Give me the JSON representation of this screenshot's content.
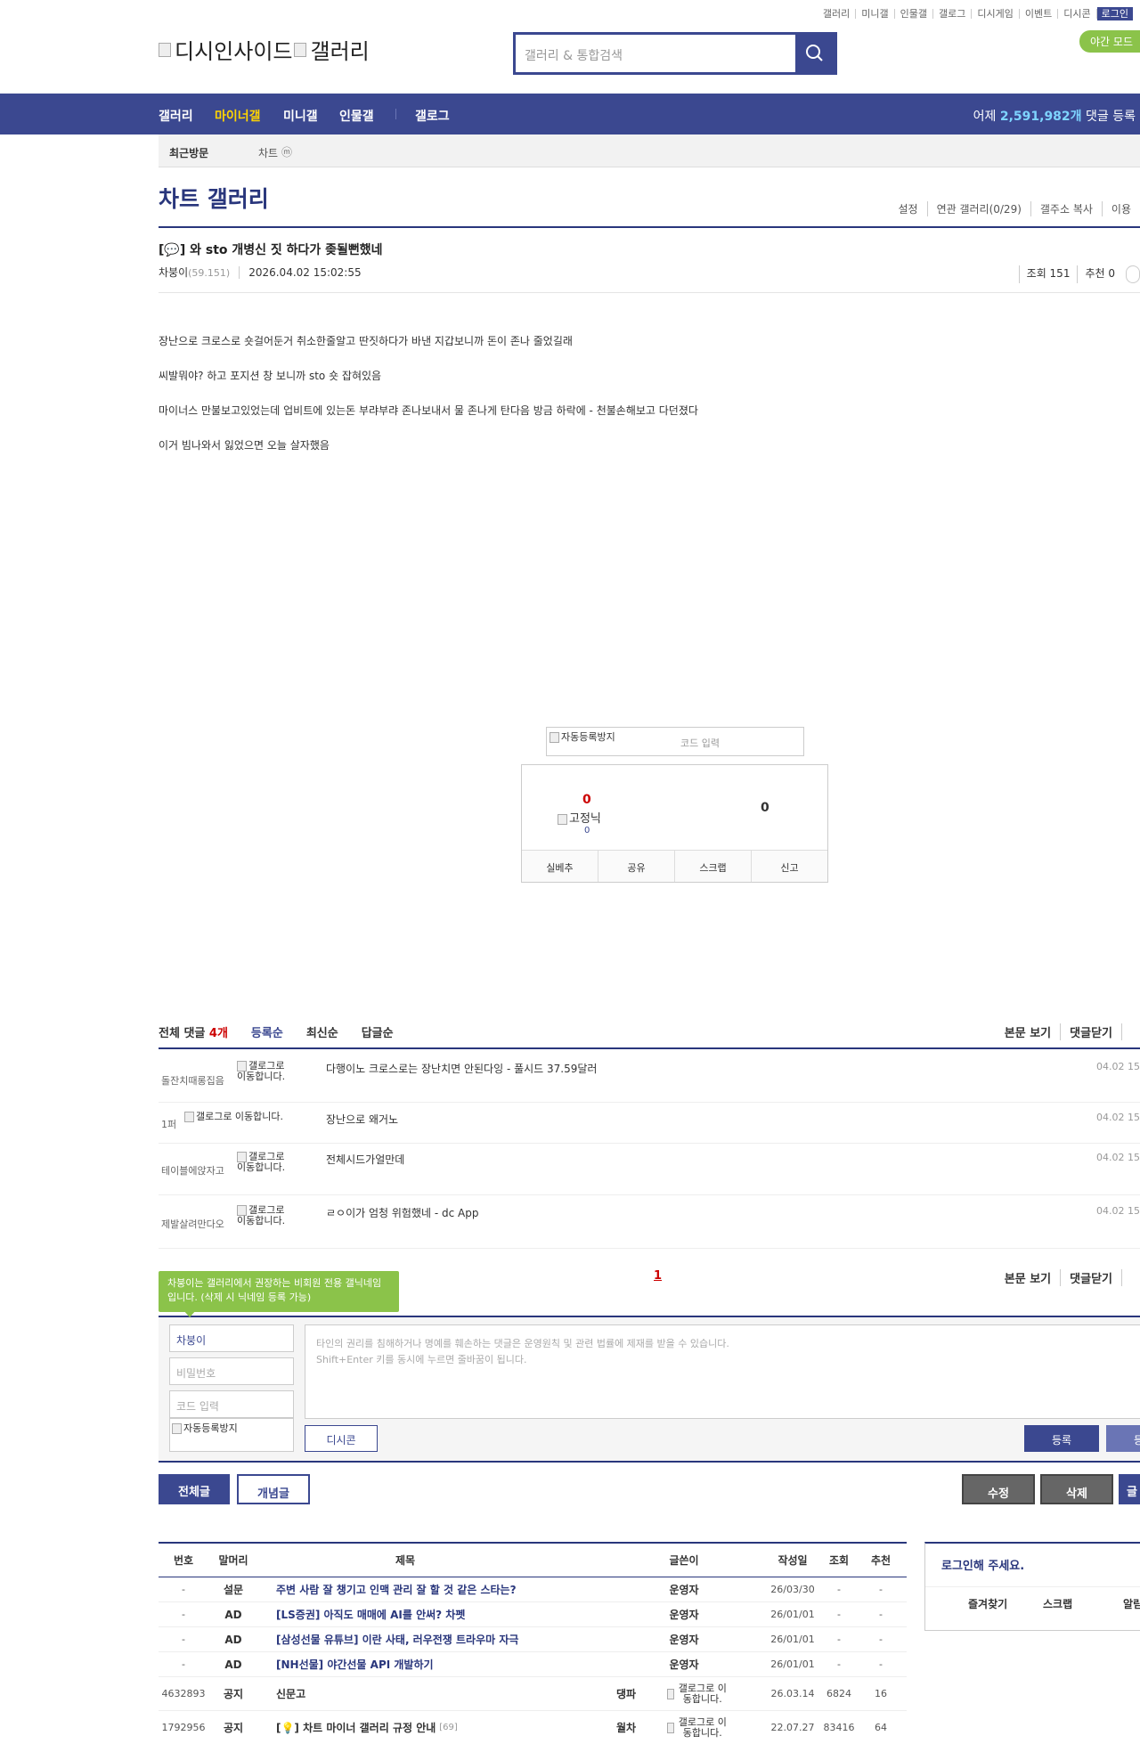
{
  "topnav": [
    "갤러리",
    "미니갤",
    "인물갤",
    "갤로그",
    "디시게임",
    "이벤트",
    "디시콘",
    "로그인"
  ],
  "night_mode": "야간 모드",
  "logo": {
    "left": "디시인사이드",
    "right": "갤러리"
  },
  "search": {
    "placeholder": "갤러리 & 통합검색"
  },
  "gnb": {
    "items": [
      "갤러리",
      "마이너갤",
      "미니갤",
      "인물갤",
      "갤로그"
    ],
    "yesterday_label": "어제",
    "yesterday_count": "2,591,982개",
    "yesterday_suffix": "댓글 등록"
  },
  "subnav": {
    "recent": "최근방문",
    "chart": "차트",
    "m": "ⓜ"
  },
  "gallery": {
    "title": "차트 갤러리",
    "tools": [
      "설정",
      "연관 갤러리(0/29)",
      "갤주소 복사",
      "이용"
    ]
  },
  "post": {
    "title": "[💬] 와 sto 개병신 짓 하다가 좆될뻔했네",
    "author": "차붕이",
    "ip": "(59.151)",
    "date": "2026.04.02 15:02:55",
    "views": "조회 151",
    "recommend": "추천 0",
    "body": [
      "장난으로 크로스로 숏걸어둔거 취소한줄알고 딴짓하다가 바낸 지갑보니까 돈이 존나 줄었길래",
      "씨발뭐야? 하고 포지션 창 보니까 sto 숏 잡혀있음",
      "마이너스 만불보고있었는데 업비트에 있는돈 부랴부랴 존나보내서 물 존나게 탄다음 방금 하락에 - 천불손해보고 다던졌다",
      "이거 빔나와서 잃었으면 오늘 살자했음"
    ]
  },
  "captcha": {
    "img": "자동등록방지",
    "placeholder": "코드 입력"
  },
  "vote": {
    "up": "0",
    "fixed": "고정닉",
    "fixed_count": "0",
    "down": "0",
    "buttons": [
      "실베추",
      "공유",
      "스크랩",
      "신고"
    ]
  },
  "comments": {
    "total_label": "전체 댓글",
    "total_count": "4개",
    "sort": [
      "등록순",
      "최신순",
      "답글순"
    ],
    "right": [
      "본문 보기",
      "댓글닫기"
    ],
    "rows": [
      {
        "nick": "돌잔치때롱집음",
        "glog": "갤로그로 이동합니다.",
        "text": "다행이노 크로스로는 장난치면 안된다잉 - 풀시드 37.59달러",
        "date": "04.02 15"
      },
      {
        "nick": "1퍼",
        "glog": "갤로그로 이동합니다.",
        "text": "장난으로 왜거노",
        "date": "04.02 15"
      },
      {
        "nick": "테이블에앉자고",
        "glog": "갤로그로 이동합니다.",
        "text": "전체시드가얼만데",
        "date": "04.02 15"
      },
      {
        "nick": "제발살려만다오",
        "glog": "갤로그로 이동합니다.",
        "text": "ㄹㅇ이가 엄청 위험했네 - dc App",
        "date": "04.02 15"
      }
    ],
    "page": "1"
  },
  "comment_form": {
    "tip": "차붕이는 갤러리에서 권장하는 비회원 전용 갤닉네임입니다. (삭제 시 닉네임 등록 가능)",
    "nick": "차붕이",
    "password": "비밀번호",
    "code": "코드 입력",
    "captcha": "자동등록방지",
    "textarea": "타인의 권리를 침해하거나 명예를 훼손하는 댓글은 운영원칙 및 관련 법률에 제재를 받을 수 있습니다.\nShift+Enter 키를 동시에 누르면 줄바꿈이 됩니다.",
    "dccon": "디시콘",
    "submit": "등록",
    "submit2": "등록"
  },
  "buttons": {
    "all": "전체글",
    "concept": "개념글",
    "edit": "수정",
    "delete": "삭제",
    "write": "글"
  },
  "list": {
    "headers": [
      "번호",
      "말머리",
      "제목",
      "글쓴이",
      "작성일",
      "조회",
      "추천"
    ],
    "rows": [
      {
        "num": "-",
        "head": "설문",
        "title": "주변 사람 잘 챙기고 인맥 관리 잘 할 것 같은 스타는?",
        "writer": "운영자",
        "date": "26/03/30",
        "views": "-",
        "rec": "-"
      },
      {
        "num": "-",
        "head": "AD",
        "title": "[LS증권] 아직도 매매에 AI를 안써? 차펫",
        "writer": "운영자",
        "date": "26/01/01",
        "views": "-",
        "rec": "-"
      },
      {
        "num": "-",
        "head": "AD",
        "title": "[삼성선물 유튜브] 이란 사태, 러우전쟁 트라우마 자극",
        "writer": "운영자",
        "date": "26/01/01",
        "views": "-",
        "rec": "-"
      },
      {
        "num": "-",
        "head": "AD",
        "title": "[NH선물] 야간선물 API 개발하기",
        "writer": "운영자",
        "date": "26/01/01",
        "views": "-",
        "rec": "-"
      },
      {
        "num": "4632893",
        "head": "공지",
        "title": "신문고",
        "writer": "댕파",
        "glog": "갤로그로 이동합니다.",
        "date": "26.03.14",
        "views": "6824",
        "rec": "16"
      },
      {
        "num": "1792956",
        "head": "공지",
        "title": "[💡] 차트 마이너 갤러리 규정 안내",
        "count": "[69]",
        "writer": "월차",
        "glog": "갤로그로 이동합니다.",
        "date": "22.07.27",
        "views": "83416",
        "rec": "64"
      }
    ]
  },
  "login_box": {
    "title": "로그인해 주세요.",
    "links": [
      "즐겨찾기",
      "스크랩",
      "알림"
    ]
  },
  "colors": {
    "brand": "#3b4890",
    "dark_brand": "#29367c",
    "green": "#8bc34a",
    "yellow": "#ffd400"
  }
}
